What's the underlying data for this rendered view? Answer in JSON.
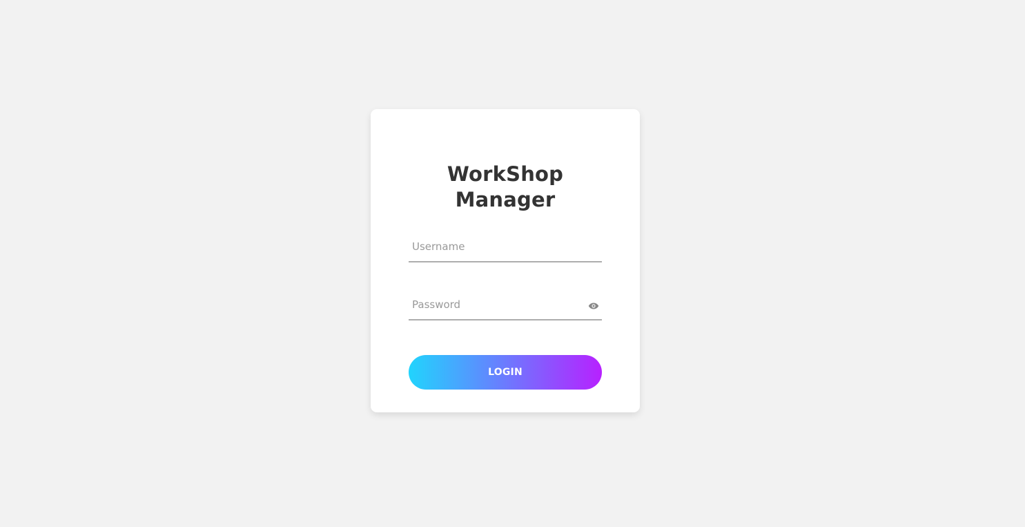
{
  "app": {
    "title": "WorkShop\nManager"
  },
  "form": {
    "username": {
      "value": "",
      "placeholder": "Username"
    },
    "password": {
      "value": "",
      "placeholder": "Password",
      "toggle_icon": "eye-icon"
    },
    "login_label": "LOGIN"
  },
  "colors": {
    "background": "#f2f2f2",
    "card": "#ffffff",
    "title": "#333333",
    "gradient_start": "#21d4fd",
    "gradient_end": "#b721ff",
    "underline": "#adadad"
  }
}
